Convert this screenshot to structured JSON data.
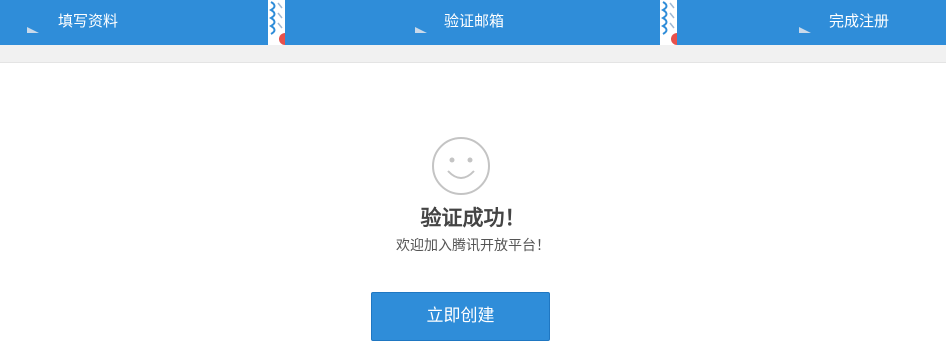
{
  "colors": {
    "primary": "#2f8dd9",
    "divider_red": "#e8514c",
    "title_text": "#444444",
    "sub_text": "#555555"
  },
  "steps": [
    {
      "label": "填写资料",
      "state": "completed"
    },
    {
      "label": "验证邮箱",
      "state": "completed"
    },
    {
      "label": "完成注册",
      "state": "current"
    }
  ],
  "result": {
    "icon": "smiley-face-icon",
    "title": "验证成功！",
    "subtitle": "欢迎加入腾讯开放平台！"
  },
  "actions": {
    "create_label": "立即创建"
  }
}
